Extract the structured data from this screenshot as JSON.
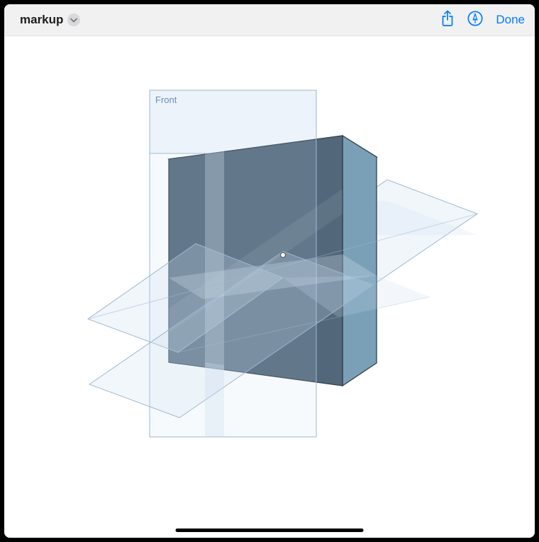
{
  "toolbar": {
    "title": "markup",
    "done_label": "Done"
  },
  "icons": {
    "chevron": "chevron-down-icon",
    "share": "share-icon",
    "annotate": "annotate-pen-icon"
  },
  "viewport": {
    "plane_label": "Front",
    "colors": {
      "face_front": "#52687a",
      "face_top": "#8bacc3",
      "face_side": "#7aa0b7",
      "plane_stroke": "#9db7d1",
      "plane_fill": "rgba(200,220,240,0.28)",
      "edge": "#35424d"
    }
  }
}
